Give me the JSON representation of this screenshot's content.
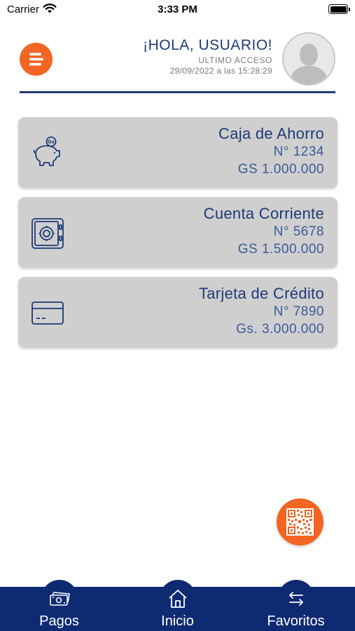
{
  "status_bar": {
    "carrier": "Carrier",
    "time": "3:33 PM",
    "battery_level": 1.0
  },
  "header": {
    "greeting": "¡HOLA, USUARIO!",
    "last_access_label": "ULTIMO ACCESO",
    "last_access_value": "29/09/2022 a las 15:28:29",
    "menu_icon": "menu-lines-icon",
    "avatar_icon": "user-silhouette-icon"
  },
  "accounts": [
    {
      "name": "Caja de Ahorro",
      "number": "N° 1234",
      "balance": "GS 1.000.000",
      "icon": "piggy-bank-icon"
    },
    {
      "name": "Cuenta Corriente",
      "number": "N° 5678",
      "balance": "GS 1.500.000",
      "icon": "safe-icon"
    },
    {
      "name": "Tarjeta de Crédito",
      "number": "N° 7890",
      "balance": "Gs. 3.000.000",
      "icon": "credit-card-icon"
    }
  ],
  "qr_button": {
    "icon": "qr-code-icon"
  },
  "bottom_nav": {
    "items": [
      {
        "label": "Pagos",
        "icon": "payments-icon"
      },
      {
        "label": "Inicio",
        "icon": "home-icon"
      },
      {
        "label": "Favoritos",
        "icon": "transfer-arrows-icon"
      }
    ]
  },
  "colors": {
    "brand_orange": "#f26522",
    "brand_navy": "#1f3a78",
    "nav_background": "#0e2a72",
    "card_background": "#cfcfcf"
  }
}
